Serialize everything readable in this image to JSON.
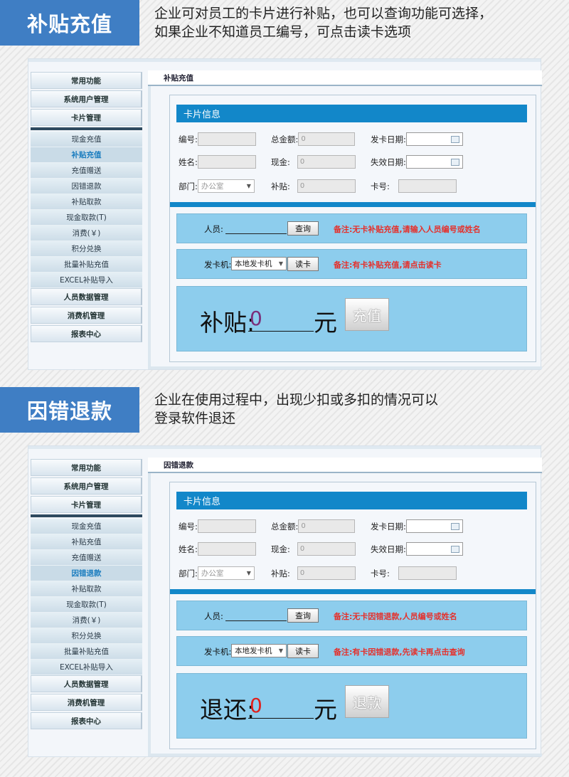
{
  "sections": [
    {
      "banner_title": "补贴充值",
      "description": [
        "企业可对员工的卡片进行补贴，也可以查询功能可选择，",
        "如果企业不知道员工编号，可点击读卡选项"
      ],
      "window": {
        "sidebar": {
          "top_heads": [
            "常用功能",
            "系统用户管理",
            "卡片管理"
          ],
          "items": [
            "现金充值",
            "补贴充值",
            "充值赠送",
            "因错退款",
            "补贴取款",
            "现金取款(T)",
            "消费(￥)",
            "积分兑换",
            "批量补贴充值",
            "EXCEL补贴导入"
          ],
          "active_index": 1,
          "bottom_heads": [
            "人员数据管理",
            "消费机管理",
            "报表中心"
          ]
        },
        "page_title": "补贴充值",
        "card_title": "卡片信息",
        "fields": {
          "id_label": "编号:",
          "id_value": "",
          "total_label": "总金额:",
          "total_value": "0",
          "issue_date_label": "发卡日期:",
          "issue_date_value": "",
          "name_label": "姓名:",
          "name_value": "",
          "cash_label": "现金:",
          "cash_value": "0",
          "expire_label": "失效日期:",
          "expire_value": "",
          "dept_label": "部门:",
          "dept_value": "办公室",
          "subsidy_label": "补贴:",
          "subsidy_value": "0",
          "card_no_label": "卡号:",
          "card_no_value": ""
        },
        "person_row": {
          "label": "人员:",
          "value": "",
          "button": "查询",
          "note": "备注:无卡补贴充值,请输入人员编号或姓名"
        },
        "reader_row": {
          "label": "发卡机:",
          "device": "本地发卡机",
          "button": "读卡",
          "note": "备注:有卡补贴充值,请点击读卡"
        },
        "amount": {
          "label": "补贴:",
          "value": "0",
          "unit": "元",
          "button": "充值",
          "value_color": "#7a2f7a"
        }
      }
    },
    {
      "banner_title": "因错退款",
      "description": [
        "企业在使用过程中，出现少扣或多扣的情况可以",
        "登录软件退还"
      ],
      "window": {
        "sidebar": {
          "top_heads": [
            "常用功能",
            "系统用户管理",
            "卡片管理"
          ],
          "items": [
            "现金充值",
            "补贴充值",
            "充值赠送",
            "因错退款",
            "补贴取款",
            "现金取款(T)",
            "消费(￥)",
            "积分兑换",
            "批量补贴充值",
            "EXCEL补贴导入"
          ],
          "active_index": 3,
          "bottom_heads": [
            "人员数据管理",
            "消费机管理",
            "报表中心"
          ]
        },
        "page_title": "因错退款",
        "card_title": "卡片信息",
        "fields": {
          "id_label": "编号:",
          "id_value": "",
          "total_label": "总金额:",
          "total_value": "0",
          "issue_date_label": "发卡日期:",
          "issue_date_value": "",
          "name_label": "姓名:",
          "name_value": "",
          "cash_label": "现金:",
          "cash_value": "0",
          "expire_label": "失效日期:",
          "expire_value": "",
          "dept_label": "部门:",
          "dept_value": "办公室",
          "subsidy_label": "补贴:",
          "subsidy_value": "0",
          "card_no_label": "卡号:",
          "card_no_value": ""
        },
        "person_row": {
          "label": "人员:",
          "value": "",
          "button": "查询",
          "note": "备注:无卡因错退款,人员编号或姓名"
        },
        "reader_row": {
          "label": "发卡机:",
          "device": "本地发卡机",
          "button": "读卡",
          "note": "备注:有卡因错退款,先读卡再点击查询"
        },
        "amount": {
          "label": "退还:",
          "value": "0",
          "unit": "元",
          "button": "退款",
          "value_color": "#e0201c"
        }
      }
    }
  ],
  "colors": {
    "banner": "#3f7ec4",
    "card_header": "#1287c9",
    "row_box": "#8dcded",
    "note_red": "#e5302b"
  },
  "icons": {
    "calendar": "calendar-icon",
    "dropdown": "chevron-down-icon"
  }
}
